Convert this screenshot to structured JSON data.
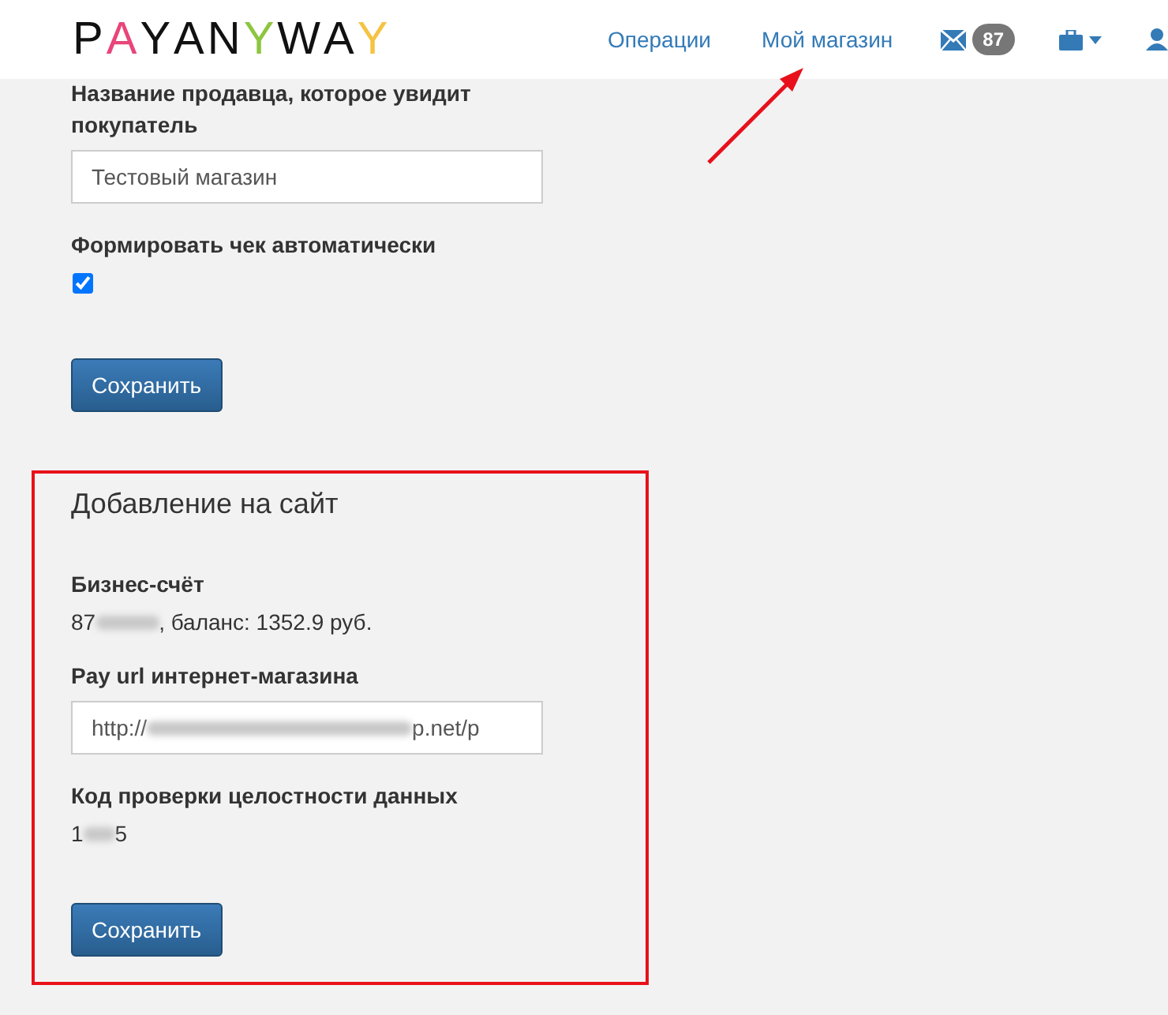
{
  "header": {
    "logo": [
      {
        "char": "P",
        "color": "#111111"
      },
      {
        "char": "A",
        "color": "#e8457a"
      },
      {
        "char": "Y",
        "color": "#111111"
      },
      {
        "char": "A",
        "color": "#111111"
      },
      {
        "char": "N",
        "color": "#111111"
      },
      {
        "char": "Y",
        "color": "#8cc63f"
      },
      {
        "char": "W",
        "color": "#111111"
      },
      {
        "char": "A",
        "color": "#111111"
      },
      {
        "char": "Y",
        "color": "#f5c242"
      }
    ],
    "nav": [
      {
        "label": "Операции",
        "selected": false
      },
      {
        "label": "Мой магазин",
        "selected": false
      }
    ],
    "mail_count": "87"
  },
  "settings": {
    "seller_name_label": "Название продавца, которое увидит покупатель",
    "seller_name_value": "Тестовый магазин",
    "receipt_label": "Формировать чек автоматически",
    "receipt_checked": true,
    "save": "Сохранить"
  },
  "site_section": {
    "title": "Добавление на сайт",
    "highlighted": true,
    "account_label": "Бизнес-счёт",
    "account_prefix": "87",
    "account_suffix": ", баланс: 1352.9 руб.",
    "payurl_label": "Pay url интернет-магазина",
    "payurl_prefix": "http://",
    "payurl_suffix": "p.net/p",
    "code_label": "Код проверки целостности данных",
    "code_prefix": "1",
    "code_suffix": "5",
    "save": "Сохранить"
  }
}
